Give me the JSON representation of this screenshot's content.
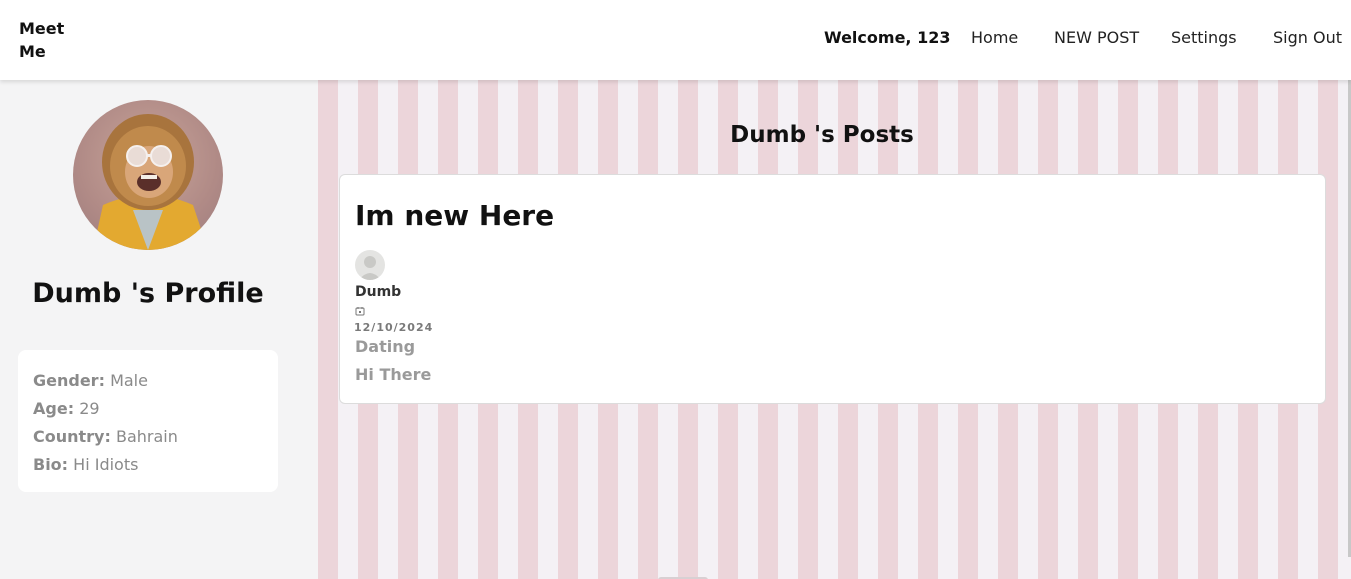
{
  "brand": {
    "name": "Meet Me"
  },
  "nav": {
    "welcome": "Welcome, 123",
    "home": "Home",
    "new_post": "NEW POST",
    "settings": "Settings",
    "sign_out": "Sign Out"
  },
  "profile": {
    "title": "Dumb 's Profile",
    "avatar_icon": "monkey-photo",
    "fields": {
      "gender_label": "Gender:",
      "gender": "Male",
      "age_label": "Age:",
      "age": "29",
      "country_label": "Country:",
      "country": "Bahrain",
      "bio_label": "Bio:",
      "bio": "Hi Idiots"
    }
  },
  "posts": {
    "title": "Dumb 's Posts",
    "items": [
      {
        "title": "Im new Here",
        "author": "Dumb",
        "date": "12/10/2024",
        "category": "Dating",
        "body": "Hi There"
      }
    ]
  },
  "colors": {
    "stripe_pink": "#ecd5da",
    "stripe_light": "#f4f1f5",
    "sidebar_bg": "#f4f4f5"
  }
}
